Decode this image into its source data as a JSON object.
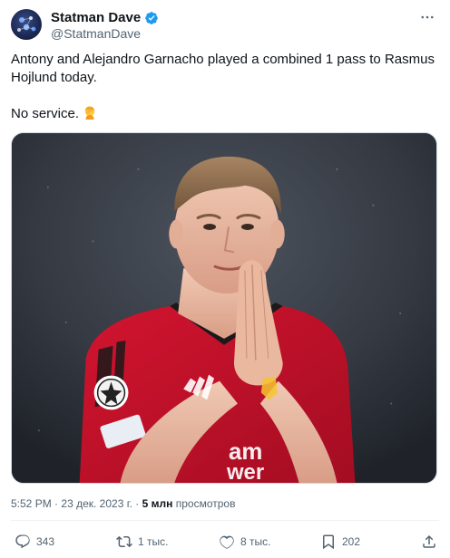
{
  "author": {
    "display_name": "Statman Dave",
    "handle": "@StatmanDave",
    "verified": true
  },
  "tweet": {
    "line1": "Antony and Alejandro Garnacho played a combined 1 pass to Rasmus Hojlund today.",
    "line2": "No service.",
    "emoji_icon": "person-facepalming-icon"
  },
  "meta": {
    "time": "5:52 PM",
    "date": "23 дек. 2023 г.",
    "separator": "·",
    "views_count": "5 млн",
    "views_label": "просмотров"
  },
  "actions": {
    "replies": "343",
    "retweets": "1 тыс.",
    "likes": "8 тыс.",
    "bookmarks": "202"
  },
  "colors": {
    "verified": "#1d9bf0",
    "text_primary": "#0f1419",
    "text_secondary": "#536471",
    "jersey_red": "#c8102e"
  }
}
